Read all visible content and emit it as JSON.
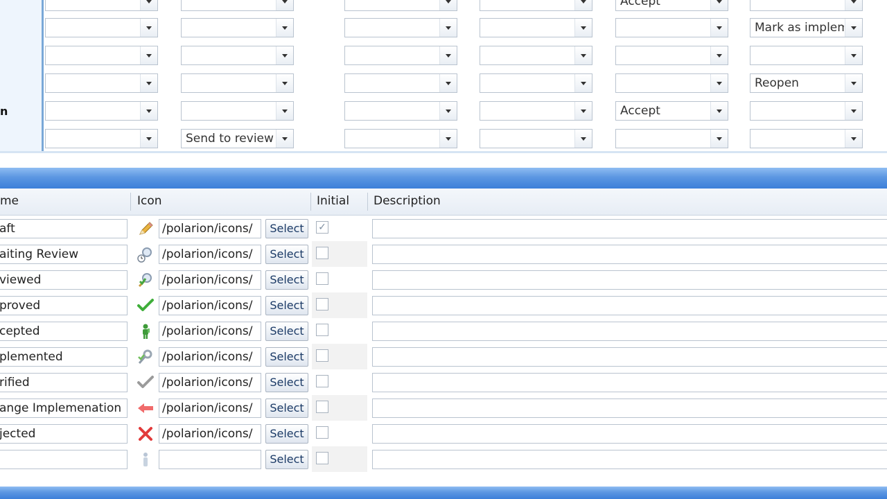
{
  "matrix": {
    "row_labels": [
      "",
      "",
      "",
      "",
      "n",
      ""
    ],
    "rows": [
      [
        "",
        "",
        "",
        "",
        "Accept",
        ""
      ],
      [
        "",
        "",
        "",
        "",
        "",
        "Mark as implemented"
      ],
      [
        "",
        "",
        "",
        "",
        "",
        ""
      ],
      [
        "",
        "",
        "",
        "",
        "",
        "Reopen"
      ],
      [
        "",
        "",
        "",
        "",
        "Accept",
        ""
      ],
      [
        "",
        "Send to review",
        "",
        "",
        "",
        ""
      ]
    ]
  },
  "states_table": {
    "headers": {
      "name": "me",
      "icon": "Icon",
      "initial": "Initial",
      "description": "Description"
    },
    "select_label": "Select",
    "rows": [
      {
        "name": "aft",
        "icon": "pencil-icon",
        "path": "/polarion/icons/",
        "initial": true
      },
      {
        "name": "aiting Review",
        "icon": "magnifier-clock-icon",
        "path": "/polarion/icons/",
        "initial": false
      },
      {
        "name": "viewed",
        "icon": "magnifier-green-icon",
        "path": "/polarion/icons/",
        "initial": false
      },
      {
        "name": "proved",
        "icon": "check-green-icon",
        "path": "/polarion/icons/",
        "initial": false
      },
      {
        "name": "cepted",
        "icon": "person-green-icon",
        "path": "/polarion/icons/",
        "initial": false
      },
      {
        "name": "plemented",
        "icon": "wrench-icon",
        "path": "/polarion/icons/",
        "initial": false
      },
      {
        "name": "rified",
        "icon": "check-gray-icon",
        "path": "/polarion/icons/",
        "initial": false
      },
      {
        "name": "ange Implemenation",
        "icon": "arrow-left-red-icon",
        "path": "/polarion/icons/",
        "initial": false
      },
      {
        "name": "jected",
        "icon": "x-red-icon",
        "path": "/polarion/icons/",
        "initial": false
      },
      {
        "name": "",
        "icon": "placeholder-person-icon",
        "path": "",
        "initial": false
      }
    ]
  },
  "colors": {
    "section_bar": "#4a8ae0",
    "rail": "#7aa8d8"
  }
}
